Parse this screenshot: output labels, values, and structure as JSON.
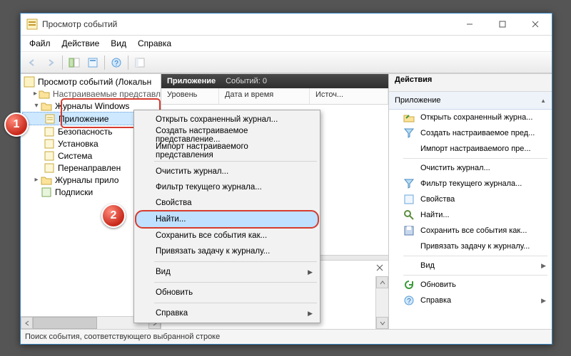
{
  "window": {
    "title": "Просмотр событий"
  },
  "menu": {
    "file": "Файл",
    "action": "Действие",
    "view": "Вид",
    "help": "Справка"
  },
  "tree": {
    "root": "Просмотр событий (Локальн",
    "custom_views": "Настраиваемые представл",
    "win_logs": "Журналы Windows",
    "application": "Приложение",
    "security": "Безопасность",
    "setup": "Установка",
    "system": "Система",
    "forwarded": "Перенаправлен",
    "app_services": "Журналы прило",
    "subscriptions": "Подписки"
  },
  "mid": {
    "header_main": "Приложение",
    "header_sub": "Событий: 0",
    "col_level": "Уровень",
    "col_datetime": "Дата и время",
    "col_source": "Источ..."
  },
  "actions": {
    "title": "Действия",
    "subtitle": "Приложение",
    "open_saved": "Открыть сохраненный журна...",
    "create_custom": "Создать настраиваемое пред...",
    "import_custom": "Импорт настраиваемого пре...",
    "clear_log": "Очистить журнал...",
    "filter_log": "Фильтр текущего журнала...",
    "properties": "Свойства",
    "find": "Найти...",
    "save_all": "Сохранить все события как...",
    "attach_task": "Привязать задачу к журналу...",
    "view": "Вид",
    "refresh": "Обновить",
    "help": "Справка"
  },
  "context": {
    "open_saved": "Открыть сохраненный журнал...",
    "create_custom": "Создать настраиваемое представление...",
    "import_custom": "Импорт настраиваемого представления",
    "clear_log": "Очистить журнал...",
    "filter_log": "Фильтр текущего журнала...",
    "properties": "Свойства",
    "find": "Найти...",
    "save_all": "Сохранить все события как...",
    "attach_task": "Привязать задачу к журналу...",
    "view": "Вид",
    "refresh": "Обновить",
    "help": "Справка"
  },
  "status": "Поиск события, соответствующего выбранной строке",
  "badges": {
    "b1": "1",
    "b2": "2"
  }
}
